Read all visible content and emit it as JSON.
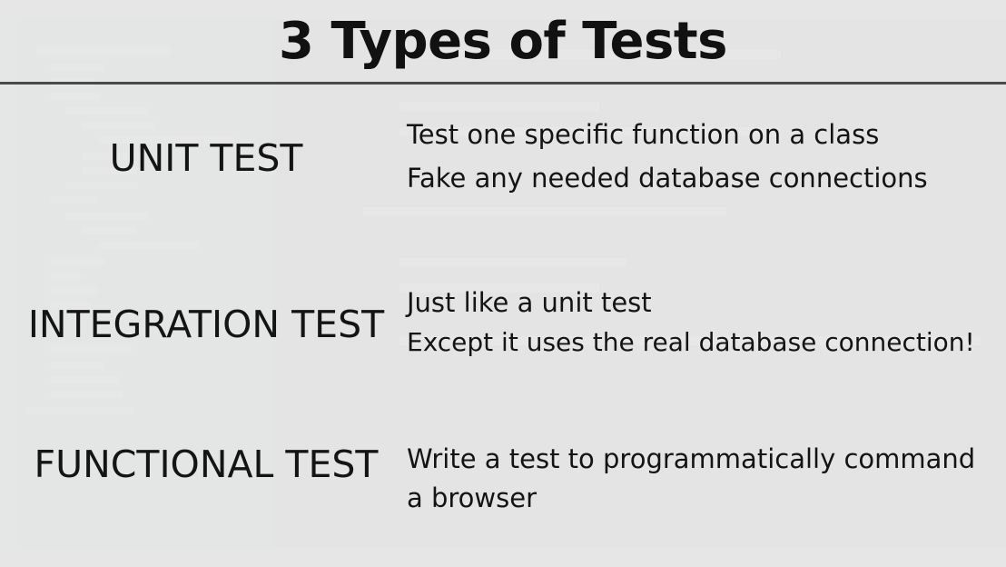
{
  "slide": {
    "title": "3 Types of Tests",
    "rows": [
      {
        "label": "UNIT TEST",
        "lines": [
          "Test one specific function on a class",
          "Fake any needed database connections"
        ]
      },
      {
        "label": "INTEGRATION TEST",
        "lines": [
          "Just like a unit test",
          "Except it uses the real database connection!"
        ]
      },
      {
        "label": "FUNCTIONAL TEST",
        "lines": [
          "Write a test to programmatically command a browser"
        ]
      }
    ]
  },
  "colors": {
    "text": "#141414",
    "divider": "#4a4a4a",
    "overlay": "#f8f8f8",
    "background": "#2b2b2b"
  }
}
